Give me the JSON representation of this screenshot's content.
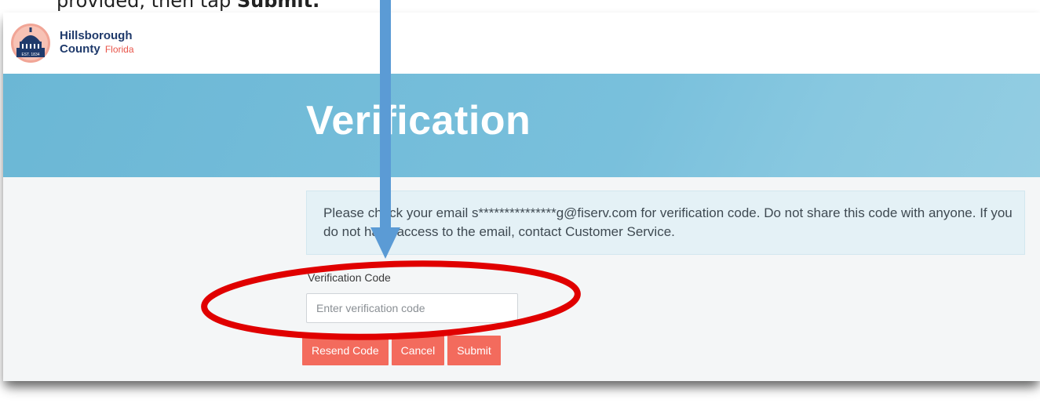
{
  "instruction": {
    "prefix": "provided, then tap ",
    "emphasis": "Submit."
  },
  "brand": {
    "line1": "Hillsborough",
    "line2": "County",
    "state": "Florida",
    "seal_text": "EST. 1834"
  },
  "page": {
    "title": "Verification"
  },
  "notice": {
    "text": "Please check your email s***************g@fiserv.com for verification code. Do not share this code with anyone. If you do not have access to the email, contact Customer Service."
  },
  "form": {
    "code_label": "Verification Code",
    "code_value": "",
    "code_placeholder": "Enter verification code"
  },
  "actions": {
    "resend_label": "Resend Code",
    "cancel_label": "Cancel",
    "submit_label": "Submit"
  },
  "colors": {
    "banner": "#79c0dc",
    "button": "#f36b5d",
    "brand_navy": "#1f3a6b",
    "annotation_circle": "#e00000",
    "annotation_arrow": "#5b9bd5"
  },
  "icons": {
    "logo": "county-seal-icon",
    "annotation_arrow": "down-arrow-icon",
    "annotation_highlight": "highlight-ellipse-icon"
  }
}
